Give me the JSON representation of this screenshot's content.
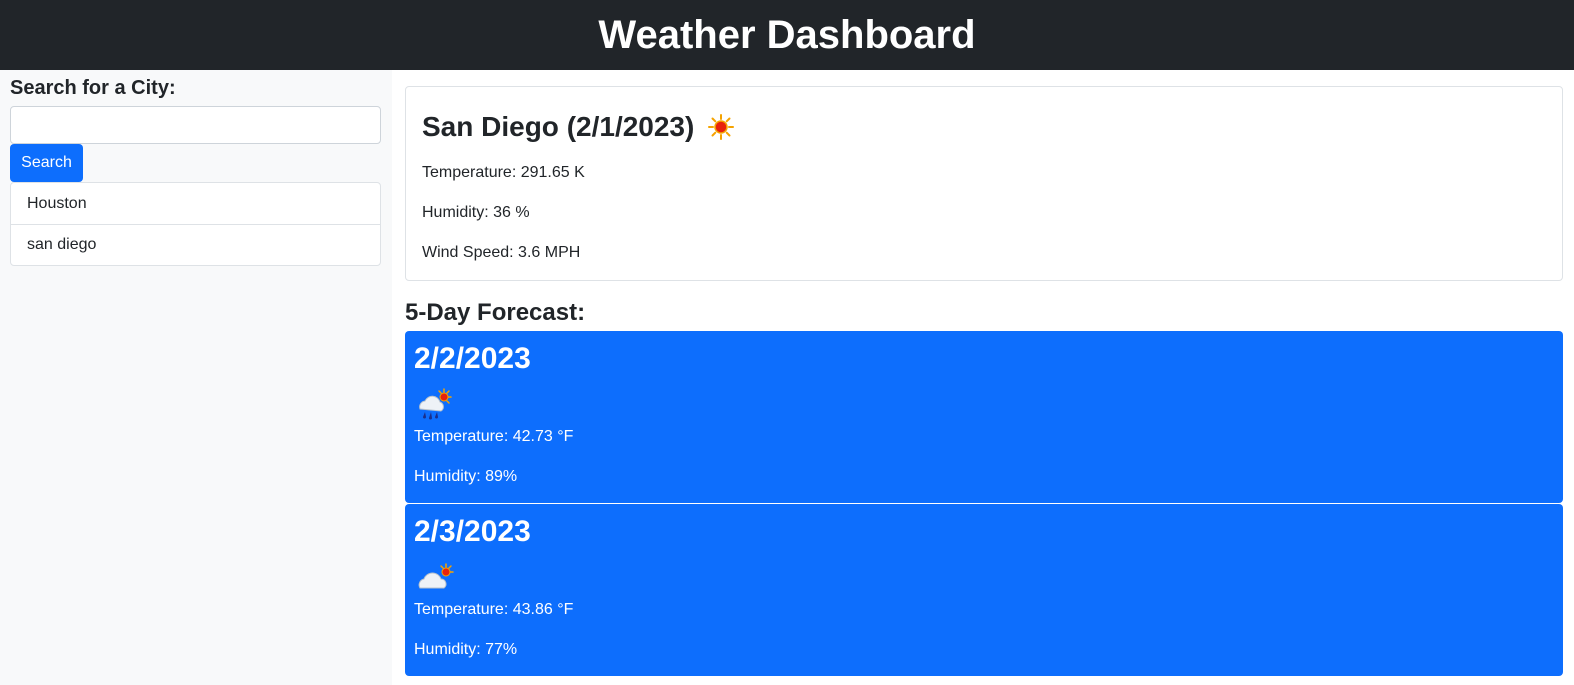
{
  "header": {
    "title": "Weather Dashboard"
  },
  "sidebar": {
    "label": "Search for a City:",
    "search_value": "",
    "search_placeholder": "",
    "search_button": "Search",
    "history": [
      {
        "label": "Houston"
      },
      {
        "label": "san diego"
      }
    ]
  },
  "current": {
    "title": "San Diego (2/1/2023)",
    "icon": "sunny-icon",
    "temperature": "Temperature: 291.65 K",
    "humidity": "Humidity: 36 %",
    "wind": "Wind Speed: 3.6 MPH"
  },
  "forecast": {
    "heading": "5-Day Forecast:",
    "days": [
      {
        "date": "2/2/2023",
        "icon": "rain-sun-cloud-icon",
        "temperature": "Temperature: 42.73 °F",
        "humidity": "Humidity: 89%"
      },
      {
        "date": "2/3/2023",
        "icon": "partly-cloudy-icon",
        "temperature": "Temperature: 43.86 °F",
        "humidity": "Humidity: 77%"
      }
    ]
  },
  "colors": {
    "header_bg": "#212529",
    "accent": "#0d6efd",
    "sidebar_bg": "#f8f9fa"
  }
}
